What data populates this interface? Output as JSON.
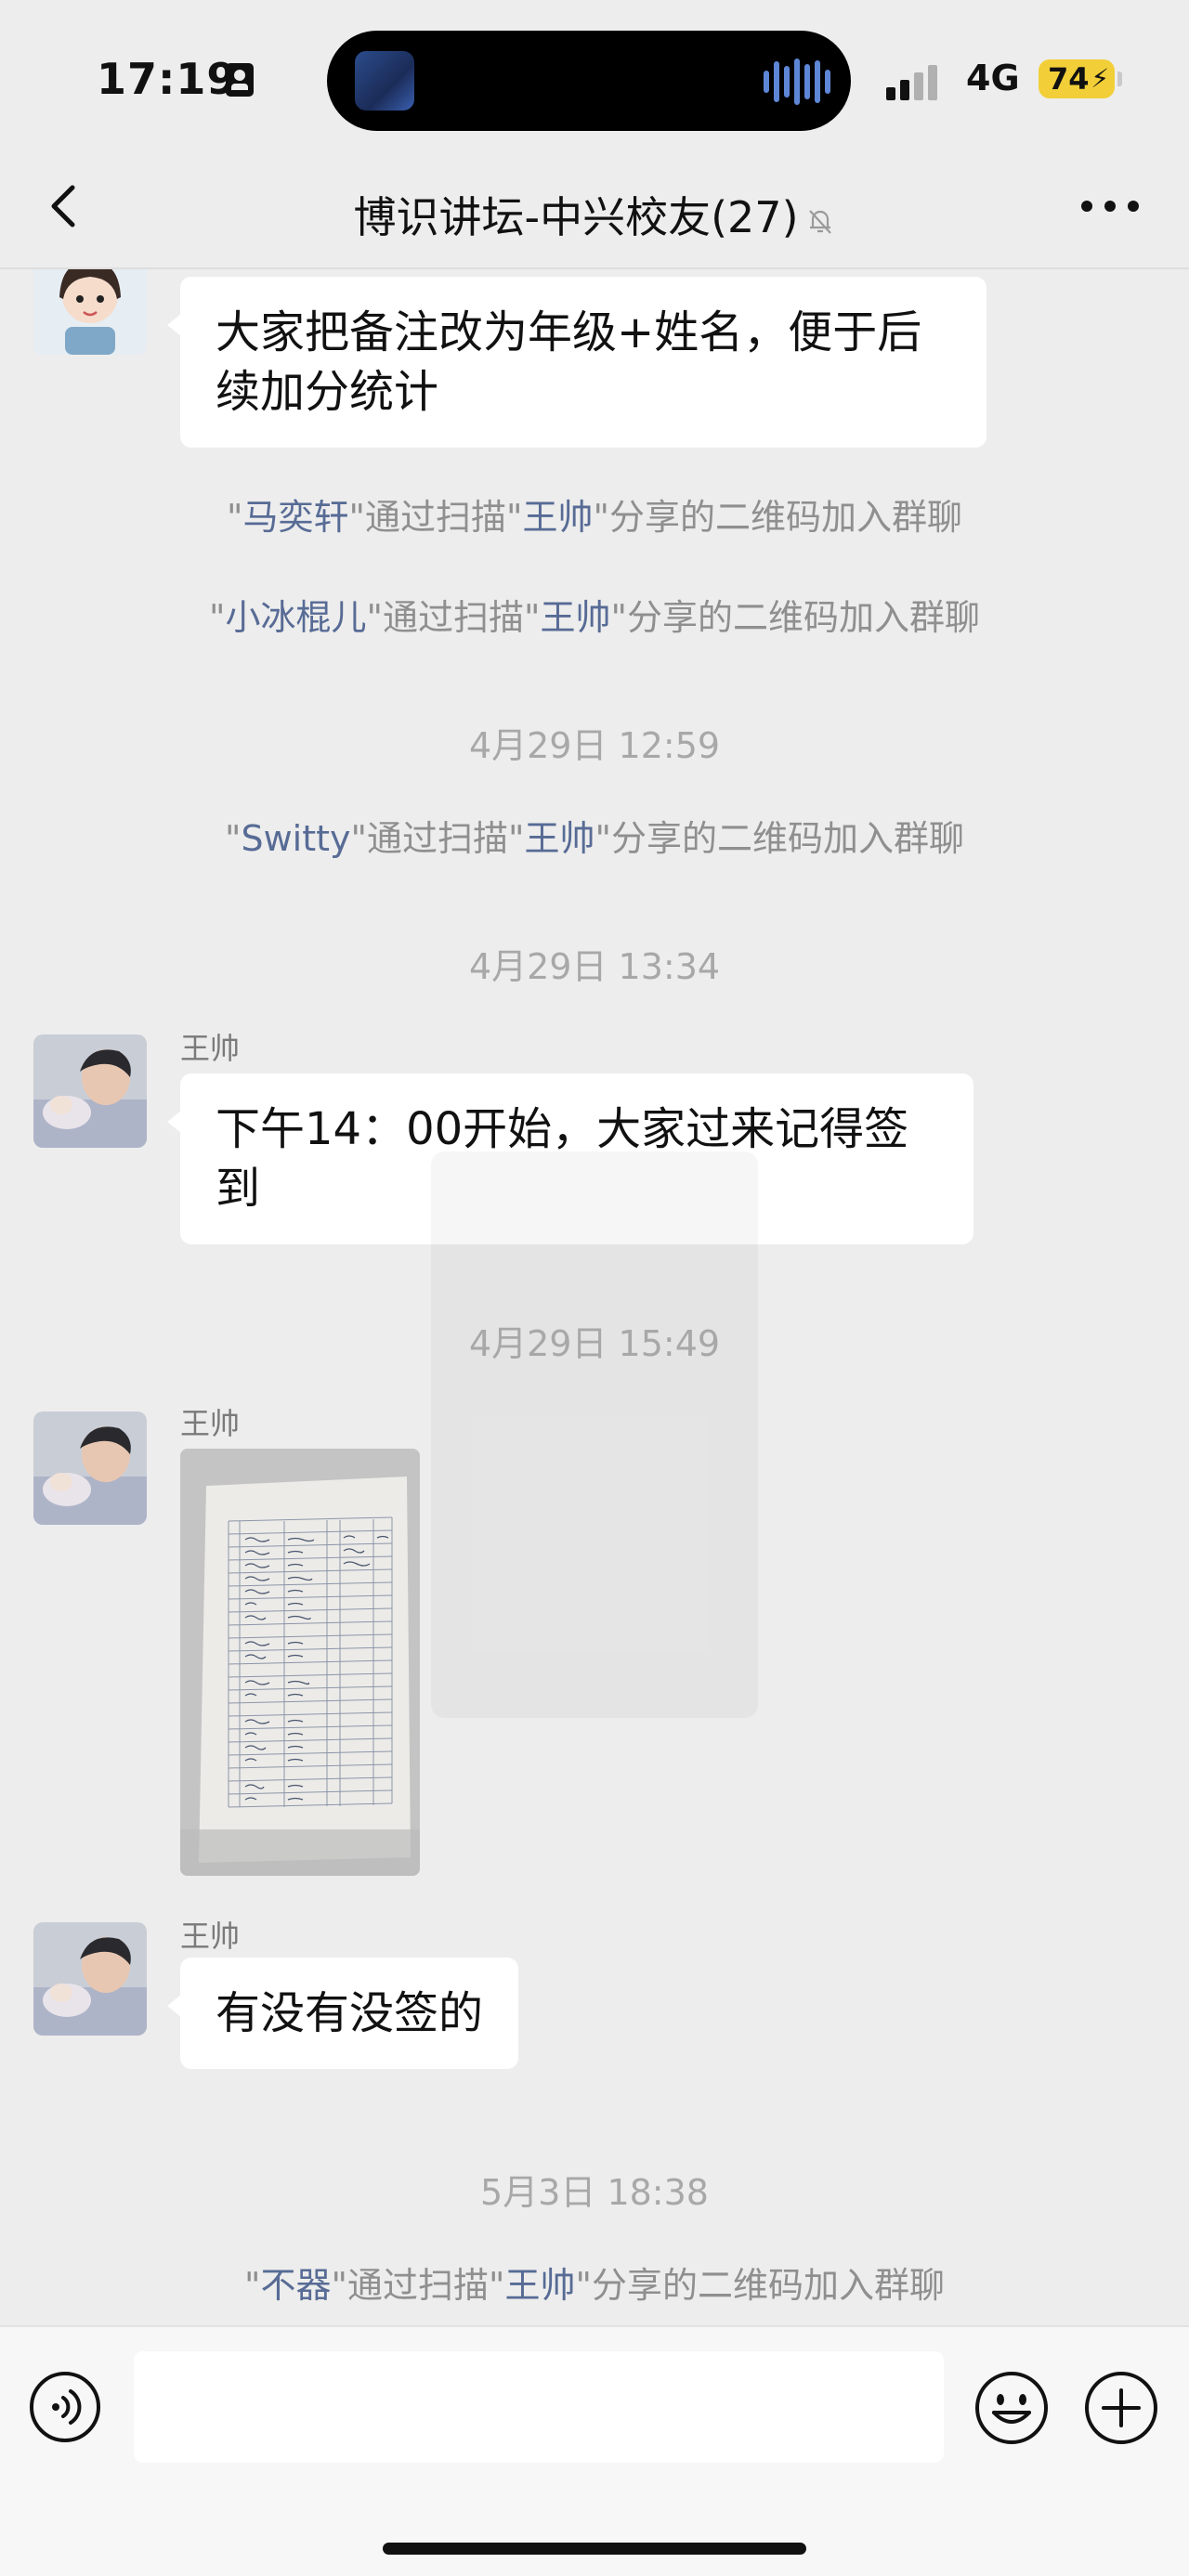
{
  "status_bar": {
    "time": "17:19",
    "network": "4G",
    "battery": "74"
  },
  "navbar": {
    "title": "博识讲坛-中兴校友(27)",
    "back_icon": "chevron-left-icon",
    "mute_icon": "bell-slash-icon",
    "more_icon": "more-dots-icon"
  },
  "messages": {
    "m1": {
      "text": "大家把备注改为年级+姓名，便于后续加分统计"
    },
    "s1": {
      "q1": "\"",
      "name": "马奕轩",
      "mid": "\"通过扫描\"",
      "inviter": "王帅",
      "tail": "\"分享的二维码加入群聊"
    },
    "s2": {
      "q1": "\"",
      "name": "小冰棍儿",
      "mid": "\"通过扫描\"",
      "inviter": "王帅",
      "tail": "\"分享的二维码加入群聊"
    },
    "t1": "4月29日 12:59",
    "s3": {
      "q1": "\"",
      "name": "Switty",
      "mid": "\"通过扫描\"",
      "inviter": "王帅",
      "tail": "\"分享的二维码加入群聊"
    },
    "t2": "4月29日 13:34",
    "m2": {
      "sender": "王帅",
      "text": "下午14：00开始，大家过来记得签到"
    },
    "t3": "4月29日 15:49",
    "m3": {
      "sender": "王帅",
      "image": "photo-of-sign-in-sheet"
    },
    "m4": {
      "sender": "王帅",
      "text": "有没有没签的"
    },
    "t4": "5月3日 18:38",
    "s4": {
      "q1": "\"",
      "name": "不器",
      "mid": "\"通过扫描\"",
      "inviter": "王帅",
      "tail": "\"分享的二维码加入群聊"
    }
  },
  "input_bar": {
    "voice_icon": "voice-icon",
    "emoji_icon": "emoji-icon",
    "plus_icon": "plus-circle-icon",
    "placeholder": ""
  },
  "colors": {
    "background": "#ededed",
    "bubble": "#ffffff",
    "name_link": "#576b95",
    "system_text": "#8f8f8f",
    "battery": "#f2cf38"
  }
}
